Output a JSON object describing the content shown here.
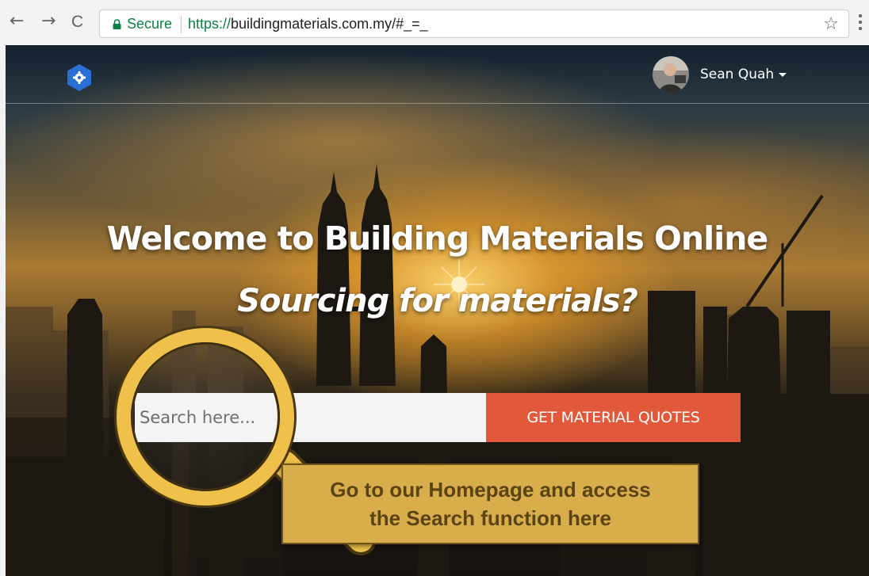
{
  "browser": {
    "secure_label": "Secure",
    "url_scheme": "https://",
    "url_rest": "buildingmaterials.com.my/#_=_",
    "back_glyph": "←",
    "forward_glyph": "→",
    "reload_glyph": "C",
    "star_glyph": "☆"
  },
  "header": {
    "user_name": "Sean Quah",
    "logo_icon": "hexagon-gear-logo-icon"
  },
  "hero": {
    "title": "Welcome to Building Materials Online",
    "subtitle": "Sourcing for materials?"
  },
  "search": {
    "placeholder": "Search here...",
    "button_label": "GET MATERIAL QUOTES"
  },
  "callout": {
    "line1": "Go to our Homepage and access",
    "line2": "the Search function here"
  },
  "colors": {
    "accent": "#e2583a",
    "secure_green": "#0b8043",
    "logo_blue": "#2a6fd6",
    "callout_gold": "#d8ad4c",
    "magnifier_ring": "#f0c14a"
  }
}
